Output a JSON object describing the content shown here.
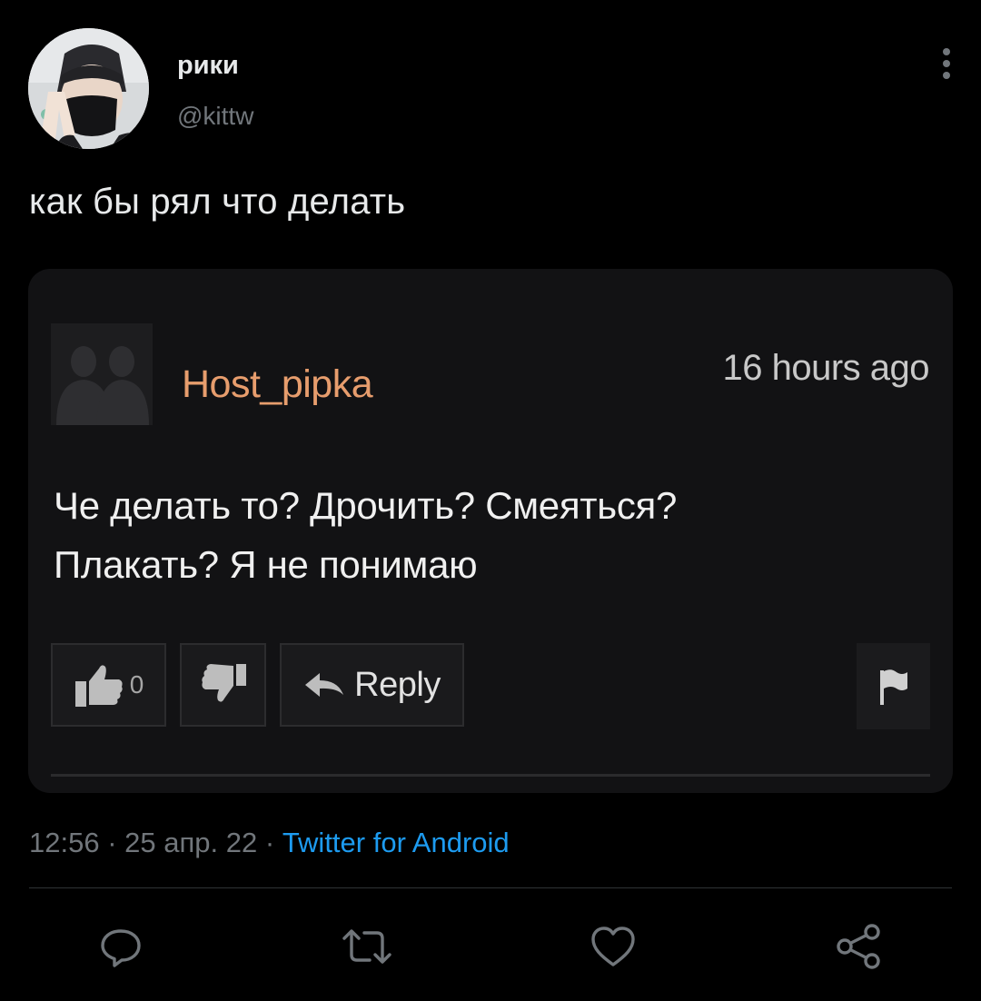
{
  "tweet": {
    "author": {
      "display_name": "рики",
      "handle": "@kittw"
    },
    "text": "как бы рял что делать",
    "meta": {
      "time": "12:56",
      "separator": "·",
      "date": "25 апр. 22",
      "source": "Twitter for Android"
    },
    "actions": [
      "reply-icon",
      "retweet-icon",
      "like-icon",
      "share-icon"
    ],
    "colors": {
      "background": "#000000",
      "text": "#e7e9ea",
      "secondary": "#71767b",
      "link": "#1d9bf0"
    }
  },
  "embedded_comment": {
    "username": "Host_pipka",
    "timestamp": "16 hours ago",
    "text_line1": "Че делать то? Дрочить? Смеяться?",
    "text_line2": "Плакать? Я не понимаю",
    "like_count": "0",
    "reply_label": "Reply",
    "colors": {
      "card_background": "#121214",
      "username": "#e79d6d"
    }
  }
}
